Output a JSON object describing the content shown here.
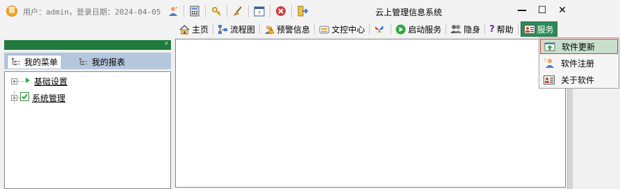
{
  "app": {
    "title": "云上管理信息系统",
    "user_info": "用户：admin，登录日期：2024-04-05",
    "app_icon_glyph": "官"
  },
  "window_controls": {
    "minimize": "—",
    "maximize": "☐",
    "close": "✕"
  },
  "quick_tools": [
    {
      "name": "user-icon"
    },
    {
      "name": "calculator-icon"
    },
    {
      "name": "key-icon"
    },
    {
      "name": "broom-icon"
    },
    {
      "name": "calendar-icon"
    },
    {
      "name": "stop-icon"
    },
    {
      "name": "exit-icon"
    }
  ],
  "menu": {
    "home": "主页",
    "flowchart": "流程图",
    "alerts": "预警信息",
    "docs": "文控中心",
    "start_service": "启动服务",
    "hide": "隐身",
    "help": "帮助",
    "service": "服务"
  },
  "panel": {
    "pin_glyph": "ᵖ",
    "tabs": [
      {
        "label": "我的菜单"
      },
      {
        "label": "我的报表"
      }
    ],
    "tree": [
      {
        "label": "基础设置",
        "expander": "+"
      },
      {
        "label": "系统管理",
        "expander": "+"
      }
    ]
  },
  "service_menu": {
    "items": [
      {
        "label": "软件更新"
      },
      {
        "label": "软件注册"
      },
      {
        "label": "关于软件"
      }
    ]
  },
  "colors": {
    "accent_green": "#2e8b57",
    "panel_header": "#1f7a3b",
    "tab_strip": "#b5c7dc",
    "hover_outline": "#d43a3a"
  }
}
